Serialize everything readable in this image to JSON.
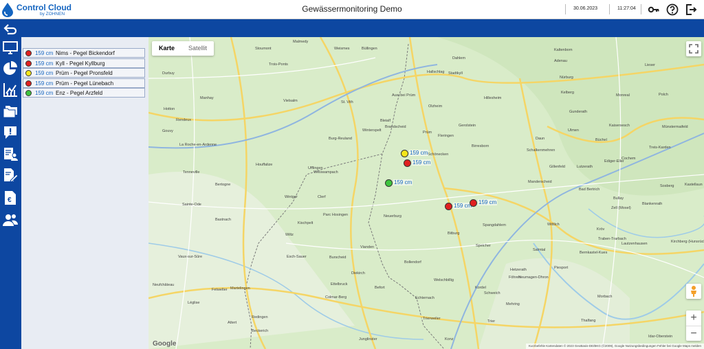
{
  "header": {
    "logo_text": "Control Cloud",
    "logo_sub": "by ZOHNEN",
    "title": "Gewässermonitoring Demo",
    "date": "30.06.2023",
    "time": "11:27:04"
  },
  "stations": [
    {
      "value": "159 cm",
      "name": "Nims - Pegel Bickendorf",
      "status": "red"
    },
    {
      "value": "159 cm",
      "name": "Kyll - Pegel Kyllburg",
      "status": "red"
    },
    {
      "value": "159 cm",
      "name": "Prüm - Pegel Pronsfeld",
      "status": "yellow"
    },
    {
      "value": "159 cm",
      "name": "Prüm - Pegel Lünebach",
      "status": "red"
    },
    {
      "value": "159 cm",
      "name": "Enz - Pegel Arzfeld",
      "status": "green"
    }
  ],
  "colors": {
    "red": "#e02020",
    "yellow": "#f5e61a",
    "green": "#3ec43e",
    "brand": "#0d47a1"
  },
  "map": {
    "tab_map": "Karte",
    "tab_satellite": "Satellit",
    "marker_label": "159 cm",
    "attribution": "Kurzbefehle   Kartendaten © 2023 GeoBasis-DE/BKG (©2009), Google   Nutzungsbedingungen   Fehler bei Google Maps melden",
    "google": "Google",
    "places": [
      "Malmedy",
      "Weismes",
      "Büllingen",
      "Dahlem",
      "Kaltenborn",
      "Stoumont",
      "Trois-Ponts",
      "Hallschlag",
      "Stadtkyll",
      "Adenau",
      "Lieser",
      "Durbuy",
      "Vielsalm",
      "St. Vith",
      "Auw bei Prüm",
      "Nürburg",
      "Kelberg",
      "Hillesheim",
      "Monreal",
      "Polch",
      "Hotton",
      "Manhay",
      "Olzheim",
      "Gerolstein",
      "Gunderath",
      "Kaisersesch",
      "Rendeux",
      "Bleialf",
      "Brandscheid",
      "Winterspelt",
      "Prüm",
      "Fleringen",
      "Ulmen",
      "Münstermaifeld",
      "Gouvy",
      "Burg-Reuland",
      "Daun",
      "Büchel",
      "Treis-Karden",
      "La Roche-en-Ardenne",
      "Schönecken",
      "Birresborn",
      "Schalkenmehren",
      "Cochem",
      "Houffalize",
      "Ufflingen",
      "Weiswampach",
      "Gillenfeld",
      "Lutzerath",
      "Ediger-Eller",
      "Tenneville",
      "Bertogne",
      "Wintger",
      "Clerf",
      "Manderscheid",
      "Bad Bertrich",
      "Bullay",
      "Sosberg",
      "Kastellaun",
      "Sainte-Ode",
      "Parc Hosingen",
      "Zell (Mosel)",
      "Blankenrath",
      "Bastnach",
      "Kischpelt",
      "Neuerburg",
      "Vianden",
      "Bitburg",
      "Spangdahlem",
      "Wittlich",
      "Kröv",
      "Traben-Trarbach",
      "Wiltz",
      "Burscheid",
      "Speicher",
      "Lautzenhausen",
      "Kirchberg (Hunsrück)",
      "Vaux-sur-Sûre",
      "Esch-Sauer",
      "Bollendorf",
      "Salmtal",
      "Bernkastel-Kues",
      "Diekirch",
      "Welschbillig",
      "Hetzerath",
      "Piesport",
      "Neufchâteau",
      "Fetwelter",
      "Martelingen",
      "Ettelbruck",
      "Befort",
      "Kordel",
      "Föhren",
      "Neumagen-Dhron",
      "Morbach",
      "Echternach",
      "Schweich",
      "Léglise",
      "Colmar-Berg",
      "Mehring",
      "Thalfang",
      "Attert",
      "Redingen",
      "Trierweiler",
      "Trier",
      "Beckerich",
      "Junglinster",
      "Konz",
      "Idar-Oberstein"
    ]
  },
  "icons": {
    "back": "back-arrow-icon",
    "nav": [
      "monitor-icon",
      "pie-chart-icon",
      "line-chart-icon",
      "folders-icon",
      "alert-icon",
      "report-user-icon",
      "edit-document-icon",
      "document-euro-icon",
      "users-icon"
    ]
  }
}
